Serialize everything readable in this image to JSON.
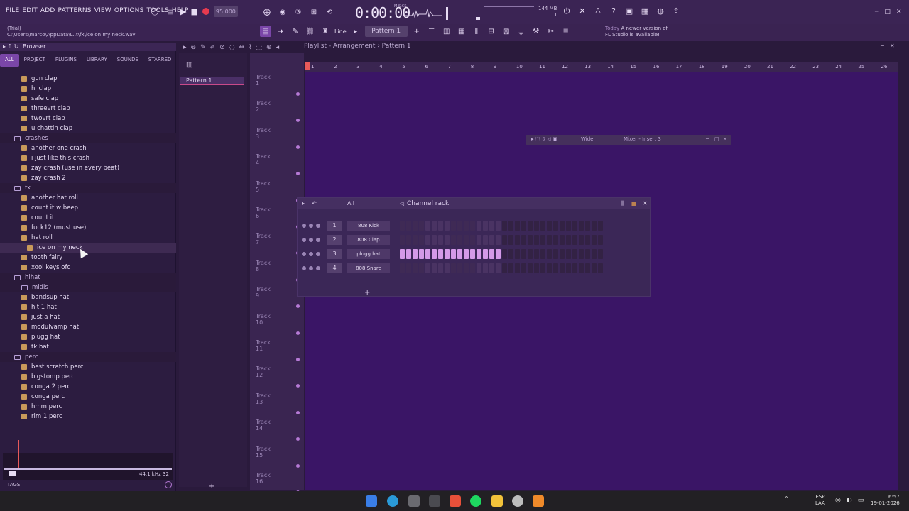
{
  "menu": [
    "FILE",
    "EDIT",
    "ADD",
    "PATTERNS",
    "VIEW",
    "OPTIONS",
    "TOOLS",
    "HELP"
  ],
  "hint": {
    "line1": "(Trial)",
    "line2": "C:\\Users\\marco\\AppData\\L..t\\fx\\ice on my neck.wav"
  },
  "tempo": "95.000",
  "time": "0:00:00",
  "time_label": "M:S:CS",
  "memory": {
    "value": "144 MB",
    "sub": "1"
  },
  "pattern_selector": "Pattern 1",
  "snap": "Line",
  "news": {
    "label": "Today",
    "line1": "A newer version of",
    "line2": "FL Studio is available!"
  },
  "browser": {
    "title": "Browser",
    "tabs": [
      "ALL",
      "PROJECT",
      "PLUGINS",
      "LIBRARY",
      "SOUNDS",
      "STARRED"
    ],
    "items": [
      {
        "label": "gun clap",
        "type": "file"
      },
      {
        "label": "hi clap",
        "type": "file"
      },
      {
        "label": "safe clap",
        "type": "file"
      },
      {
        "label": "threevrt clap",
        "type": "file"
      },
      {
        "label": "twovrt clap",
        "type": "file"
      },
      {
        "label": "u chattin clap",
        "type": "file"
      },
      {
        "label": "crashes",
        "type": "folder"
      },
      {
        "label": "another one crash",
        "type": "file"
      },
      {
        "label": "i just like this crash",
        "type": "file"
      },
      {
        "label": "zay crash (use in every beat)",
        "type": "file"
      },
      {
        "label": "zay crash 2",
        "type": "file"
      },
      {
        "label": "fx",
        "type": "folder"
      },
      {
        "label": "another hat roll",
        "type": "file"
      },
      {
        "label": "count it w beep",
        "type": "file"
      },
      {
        "label": "count it",
        "type": "file"
      },
      {
        "label": "fuck12 (must use)",
        "type": "file"
      },
      {
        "label": "hat roll",
        "type": "file"
      },
      {
        "label": "ice on my neck",
        "type": "file",
        "selected": true
      },
      {
        "label": "tooth fairy",
        "type": "file"
      },
      {
        "label": "xool keys ofc",
        "type": "file"
      },
      {
        "label": "hihat",
        "type": "folder"
      },
      {
        "label": "midis",
        "type": "folder"
      },
      {
        "label": "bandsup hat",
        "type": "file"
      },
      {
        "label": "hit 1 hat",
        "type": "file"
      },
      {
        "label": "just a hat",
        "type": "file"
      },
      {
        "label": "modulvamp hat",
        "type": "file"
      },
      {
        "label": "plugg hat",
        "type": "file"
      },
      {
        "label": "tk hat",
        "type": "file"
      },
      {
        "label": "perc",
        "type": "folder"
      },
      {
        "label": "best scratch perc",
        "type": "file"
      },
      {
        "label": "bigstomp perc",
        "type": "file"
      },
      {
        "label": "conga 2 perc",
        "type": "file"
      },
      {
        "label": "conga perc",
        "type": "file"
      },
      {
        "label": "hmm perc",
        "type": "file"
      },
      {
        "label": "rim 1 perc",
        "type": "file"
      }
    ],
    "wave_info": "44.1 kHz 32",
    "tags_label": "TAGS"
  },
  "pattern_list": {
    "item": "Pattern 1"
  },
  "playlist": {
    "title": "Playlist - Arrangement › Pattern 1",
    "bars": [
      "1",
      "2",
      "3",
      "4",
      "5",
      "6",
      "7",
      "8",
      "9",
      "10",
      "11",
      "12",
      "13",
      "14",
      "15",
      "16",
      "17",
      "18",
      "19",
      "20",
      "21",
      "22",
      "23",
      "24",
      "25",
      "26"
    ],
    "tracks": [
      "Track 1",
      "Track 2",
      "Track 3",
      "Track 4",
      "Track 5",
      "Track 6",
      "Track 7",
      "Track 8",
      "Track 9",
      "Track 10",
      "Track 11",
      "Track 12",
      "Track 13",
      "Track 14",
      "Track 15",
      "Track 16"
    ]
  },
  "mixer": {
    "preset": "Wide",
    "title": "Mixer - Insert 3"
  },
  "channel_rack": {
    "title": "Channel rack",
    "filter": "All",
    "channels": [
      {
        "num": "1",
        "name": "808 Kick",
        "steps": [
          0,
          0,
          0,
          0,
          0,
          0,
          0,
          0,
          0,
          0,
          0,
          0,
          0,
          0,
          0,
          0
        ]
      },
      {
        "num": "2",
        "name": "808 Clap",
        "steps": [
          0,
          0,
          0,
          0,
          0,
          0,
          0,
          0,
          0,
          0,
          0,
          0,
          0,
          0,
          0,
          0
        ]
      },
      {
        "num": "3",
        "name": "plugg hat",
        "steps": [
          1,
          1,
          1,
          1,
          1,
          1,
          1,
          1,
          1,
          1,
          1,
          1,
          1,
          1,
          1,
          1
        ]
      },
      {
        "num": "4",
        "name": "808 Snare",
        "steps": [
          0,
          0,
          0,
          0,
          0,
          0,
          0,
          0,
          0,
          0,
          0,
          0,
          0,
          0,
          0,
          0
        ]
      }
    ]
  },
  "taskbar": {
    "lang1": "ESP",
    "lang2": "LAA",
    "time": "6:57",
    "date": "19-01-2026"
  },
  "colors": {
    "accent": "#7a46a8",
    "step_on": "#d49ae8",
    "grid": "#3a1566"
  }
}
